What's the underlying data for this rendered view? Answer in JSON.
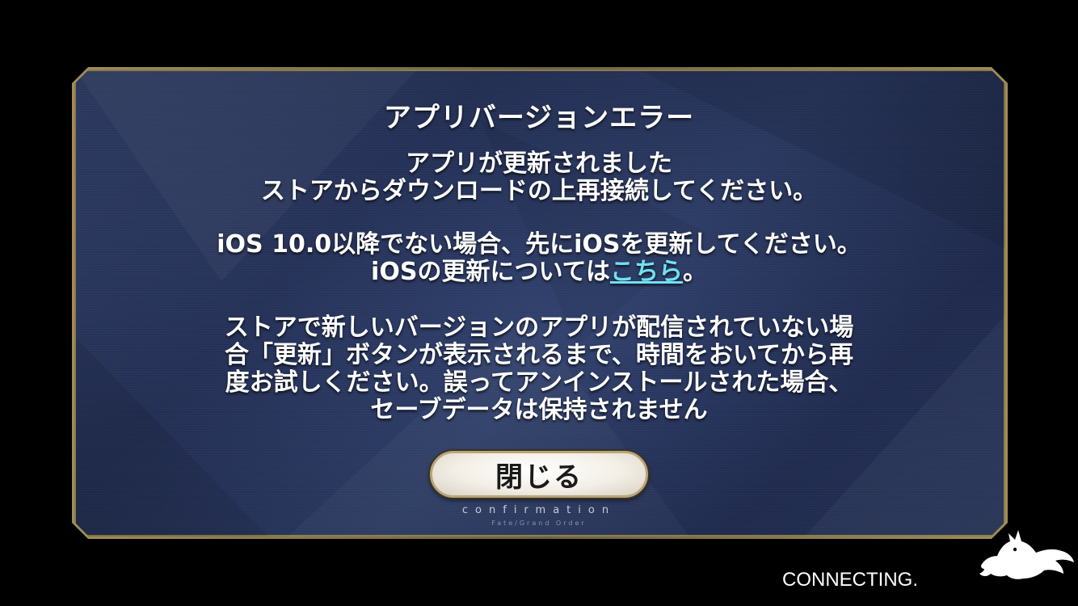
{
  "dialog": {
    "title": "アプリバージョンエラー",
    "message1_line1": "アプリが更新されました",
    "message1_line2": "ストアからダウンロードの上再接続してください。",
    "message2_line1": "iOS 10.0以降でない場合、先にiOSを更新してください。",
    "message2_line2_prefix": "iOSの更新については",
    "message2_link": "こちら",
    "message2_line2_suffix": "。",
    "message3_line1": "ストアで新しいバージョンのアプリが配信されていない場",
    "message3_line2": "合「更新」ボタンが表示されるまで、時間をおいてから再",
    "message3_line3": "度お試しください。誤ってアンインストールされた場合、",
    "message3_line4": "セーブデータは保持されません",
    "close_button": "閉じる",
    "footer_confirmation": "confirmation",
    "footer_brand": "Fate/Grand Order"
  },
  "status": {
    "connecting": "CONNECTING."
  },
  "icons": {
    "mascot": "fou-silhouette-icon"
  },
  "colors": {
    "link": "#6fe1f2",
    "panel": "#2f3f6b",
    "frame": "#8a7a4a"
  }
}
